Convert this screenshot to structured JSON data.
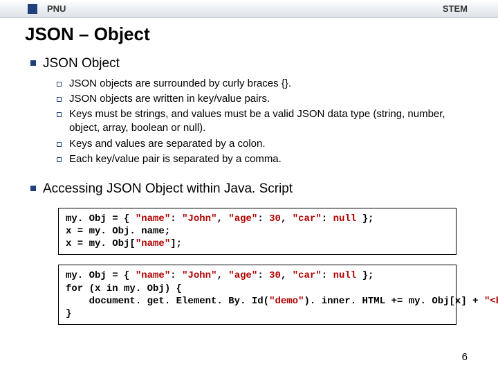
{
  "header": {
    "left": "PNU",
    "right": "STEM"
  },
  "title": "JSON – Object",
  "sections": [
    {
      "heading": "JSON Object",
      "bullets": [
        "JSON objects are surrounded by curly braces {}.",
        "JSON objects are written in key/value pairs.",
        "Keys must be strings, and values must be a valid JSON data type (string, number, object, array, boolean or null).",
        "Keys and values are separated by a colon.",
        "Each key/value pair is separated by a comma."
      ]
    },
    {
      "heading": "Accessing JSON Object within Java. Script",
      "code_blocks": [
        [
          {
            "segments": [
              {
                "t": "my. Obj = { ",
                "c": "kw"
              },
              {
                "t": "\"name\"",
                "c": "str"
              },
              {
                "t": ": ",
                "c": "kw"
              },
              {
                "t": "\"John\"",
                "c": "str"
              },
              {
                "t": ", ",
                "c": "kw"
              },
              {
                "t": "\"age\"",
                "c": "str"
              },
              {
                "t": ": ",
                "c": "kw"
              },
              {
                "t": "30",
                "c": "num"
              },
              {
                "t": ", ",
                "c": "kw"
              },
              {
                "t": "\"car\"",
                "c": "str"
              },
              {
                "t": ": ",
                "c": "kw"
              },
              {
                "t": "null",
                "c": "nul"
              },
              {
                "t": " };",
                "c": "kw"
              }
            ]
          },
          {
            "segments": [
              {
                "t": "x = my. Obj. name;",
                "c": "kw"
              }
            ]
          },
          {
            "segments": [
              {
                "t": "x = my. Obj[",
                "c": "kw"
              },
              {
                "t": "\"name\"",
                "c": "str"
              },
              {
                "t": "];",
                "c": "kw"
              }
            ]
          }
        ],
        [
          {
            "segments": [
              {
                "t": "my. Obj = { ",
                "c": "kw"
              },
              {
                "t": "\"name\"",
                "c": "str"
              },
              {
                "t": ": ",
                "c": "kw"
              },
              {
                "t": "\"John\"",
                "c": "str"
              },
              {
                "t": ", ",
                "c": "kw"
              },
              {
                "t": "\"age\"",
                "c": "str"
              },
              {
                "t": ": ",
                "c": "kw"
              },
              {
                "t": "30",
                "c": "num"
              },
              {
                "t": ", ",
                "c": "kw"
              },
              {
                "t": "\"car\"",
                "c": "str"
              },
              {
                "t": ": ",
                "c": "kw"
              },
              {
                "t": "null",
                "c": "nul"
              },
              {
                "t": " };",
                "c": "kw"
              }
            ]
          },
          {
            "segments": [
              {
                "t": "for (x in my. Obj) {",
                "c": "kw"
              }
            ]
          },
          {
            "segments": [
              {
                "t": "    document. get. Element. By. Id(",
                "c": "kw"
              },
              {
                "t": "\"demo\"",
                "c": "str"
              },
              {
                "t": "). inner. HTML += my. Obj[x] + ",
                "c": "kw"
              },
              {
                "t": "\"<br>\"",
                "c": "str"
              },
              {
                "t": ";",
                "c": "kw"
              }
            ]
          },
          {
            "segments": [
              {
                "t": "}",
                "c": "kw"
              }
            ]
          }
        ]
      ]
    }
  ],
  "page_number": "6"
}
